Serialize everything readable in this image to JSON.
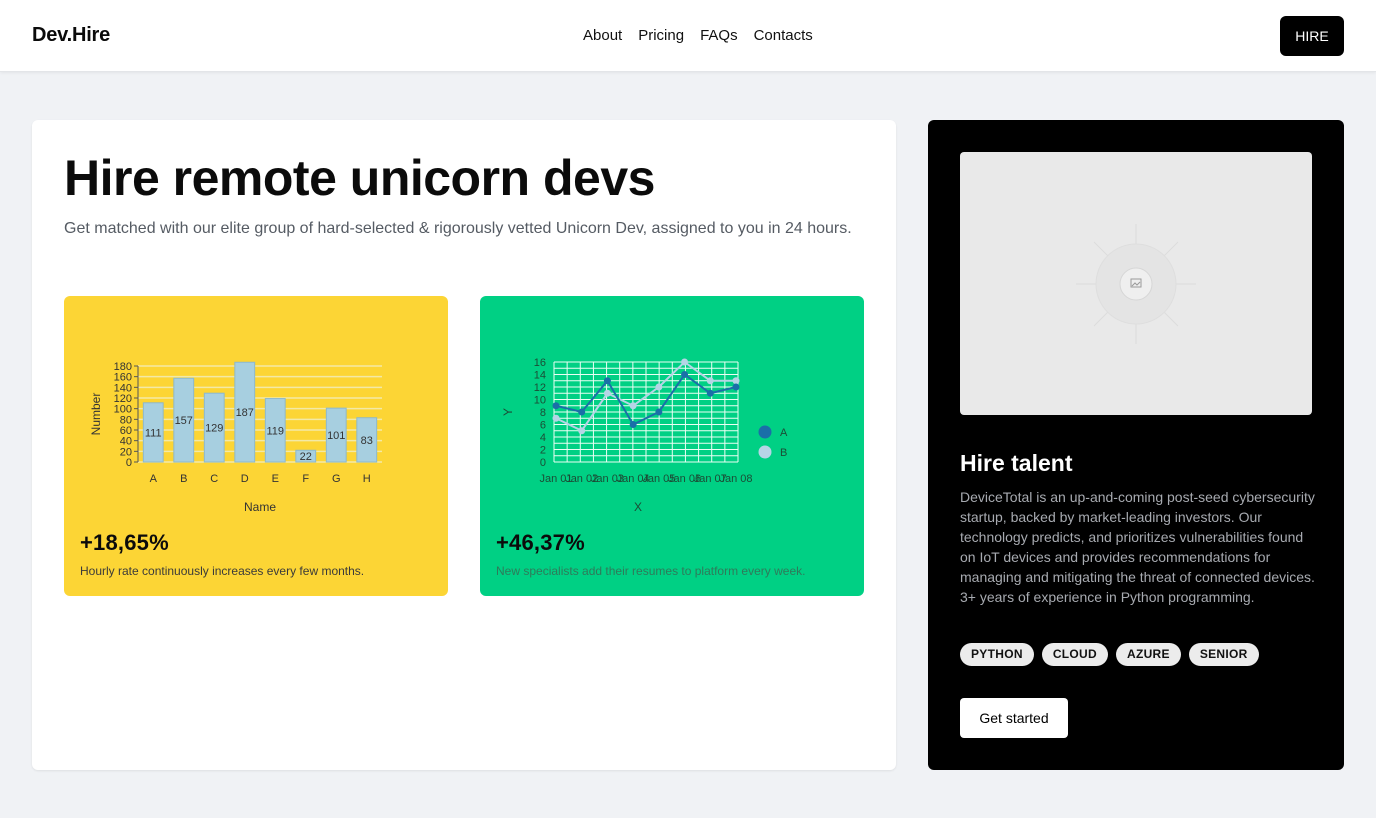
{
  "header": {
    "logo": "Dev.Hire",
    "nav": [
      "About",
      "Pricing",
      "FAQs",
      "Contacts"
    ],
    "hire_label": "HIRE"
  },
  "hero": {
    "title": "Hire remote unicorn devs",
    "subtitle": "Get matched with our elite group of hard-selected & rigorously vetted Unicorn Dev, assigned to you in 24 hours."
  },
  "stats": [
    {
      "value": "+18,65%",
      "description": "Hourly rate continuously increases every few months."
    },
    {
      "value": "+46,37%",
      "description": "New specialists add their resumes to platform every week."
    }
  ],
  "chart_data": [
    {
      "type": "bar",
      "categories": [
        "A",
        "B",
        "C",
        "D",
        "E",
        "F",
        "G",
        "H"
      ],
      "values": [
        111,
        157,
        129,
        187,
        119,
        22,
        101,
        83
      ],
      "xlabel": "Name",
      "ylabel": "Number",
      "ylim": [
        0,
        180
      ],
      "yticks": [
        0,
        20,
        40,
        60,
        80,
        100,
        120,
        140,
        160,
        180
      ],
      "grid": true,
      "bar_color": "#a7cfe0",
      "grid_color": "#f3e9a6"
    },
    {
      "type": "line",
      "x": [
        "Jan 01",
        "Jan 02",
        "Jan 03",
        "Jan 04",
        "Jan 05",
        "Jan 06",
        "Jan 07",
        "Jan 08"
      ],
      "series": [
        {
          "name": "A",
          "values": [
            9,
            8,
            13,
            6,
            8,
            14,
            11,
            12
          ],
          "color": "#1a6fa8"
        },
        {
          "name": "B",
          "values": [
            7,
            5,
            11,
            9,
            12,
            16,
            13,
            13
          ],
          "color": "#b6d4e6"
        }
      ],
      "xlabel": "X",
      "ylabel": "Y",
      "ylim": [
        0,
        16
      ],
      "yticks": [
        0,
        2,
        4,
        6,
        8,
        10,
        12,
        14,
        16
      ],
      "grid": true,
      "legend": "right"
    }
  ],
  "sidebar": {
    "title": "Hire talent",
    "description": "DeviceTotal is an up-and-coming post-seed cybersecurity startup, backed by market-leading investors. Our technology predicts, and prioritizes vulnerabilities found on IoT devices and provides recommendations for managing and mitigating the threat of connected devices. 3+ years of experience in Python programming.",
    "tags": [
      "PYTHON",
      "CLOUD",
      "AZURE",
      "SENIOR"
    ],
    "cta": "Get started"
  },
  "colors": {
    "yellow_card": "#fcd535",
    "green_card": "#00d084",
    "side_card": "#000000"
  }
}
